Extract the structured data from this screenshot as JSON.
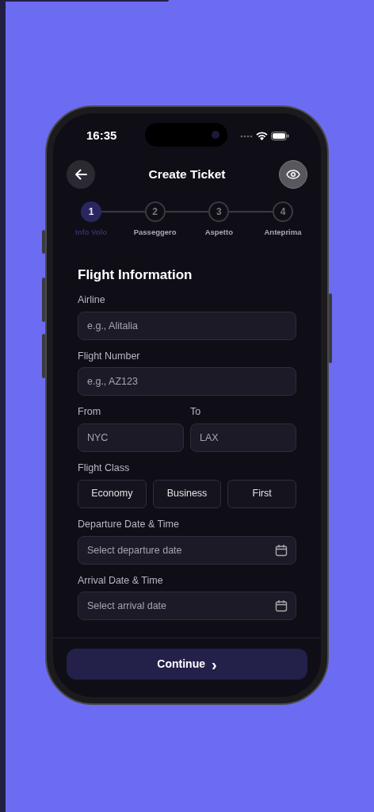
{
  "status_bar": {
    "time": "16:35"
  },
  "header": {
    "title": "Create Ticket"
  },
  "steps": [
    {
      "number": "1",
      "label": "Info Volo",
      "selected": true
    },
    {
      "number": "2",
      "label": "Passeggero",
      "selected": false
    },
    {
      "number": "3",
      "label": "Aspetto",
      "selected": false
    },
    {
      "number": "4",
      "label": "Anteprima",
      "selected": false
    }
  ],
  "section_title": "Flight Information",
  "fields": [
    {
      "kind": "text",
      "label": "Airline",
      "placeholder": "e.g., Alitalia"
    },
    {
      "kind": "text",
      "label": "Flight Number",
      "placeholder": "e.g., AZ123"
    },
    {
      "kind": "pair",
      "items": [
        {
          "label": "From",
          "placeholder": "NYC"
        },
        {
          "label": "To",
          "placeholder": "LAX"
        }
      ]
    },
    {
      "kind": "choice",
      "label": "Flight Class",
      "options": [
        {
          "label": "Economy",
          "selected": false
        },
        {
          "label": "Business",
          "selected": false
        },
        {
          "label": "First",
          "selected": false
        }
      ]
    },
    {
      "kind": "date",
      "label": "Departure Date & Time",
      "placeholder": "Select departure date"
    },
    {
      "kind": "date",
      "label": "Arrival Date & Time",
      "placeholder": "Select arrival date"
    }
  ],
  "continue_button": {
    "label": "Continue",
    "arrow": "›"
  }
}
